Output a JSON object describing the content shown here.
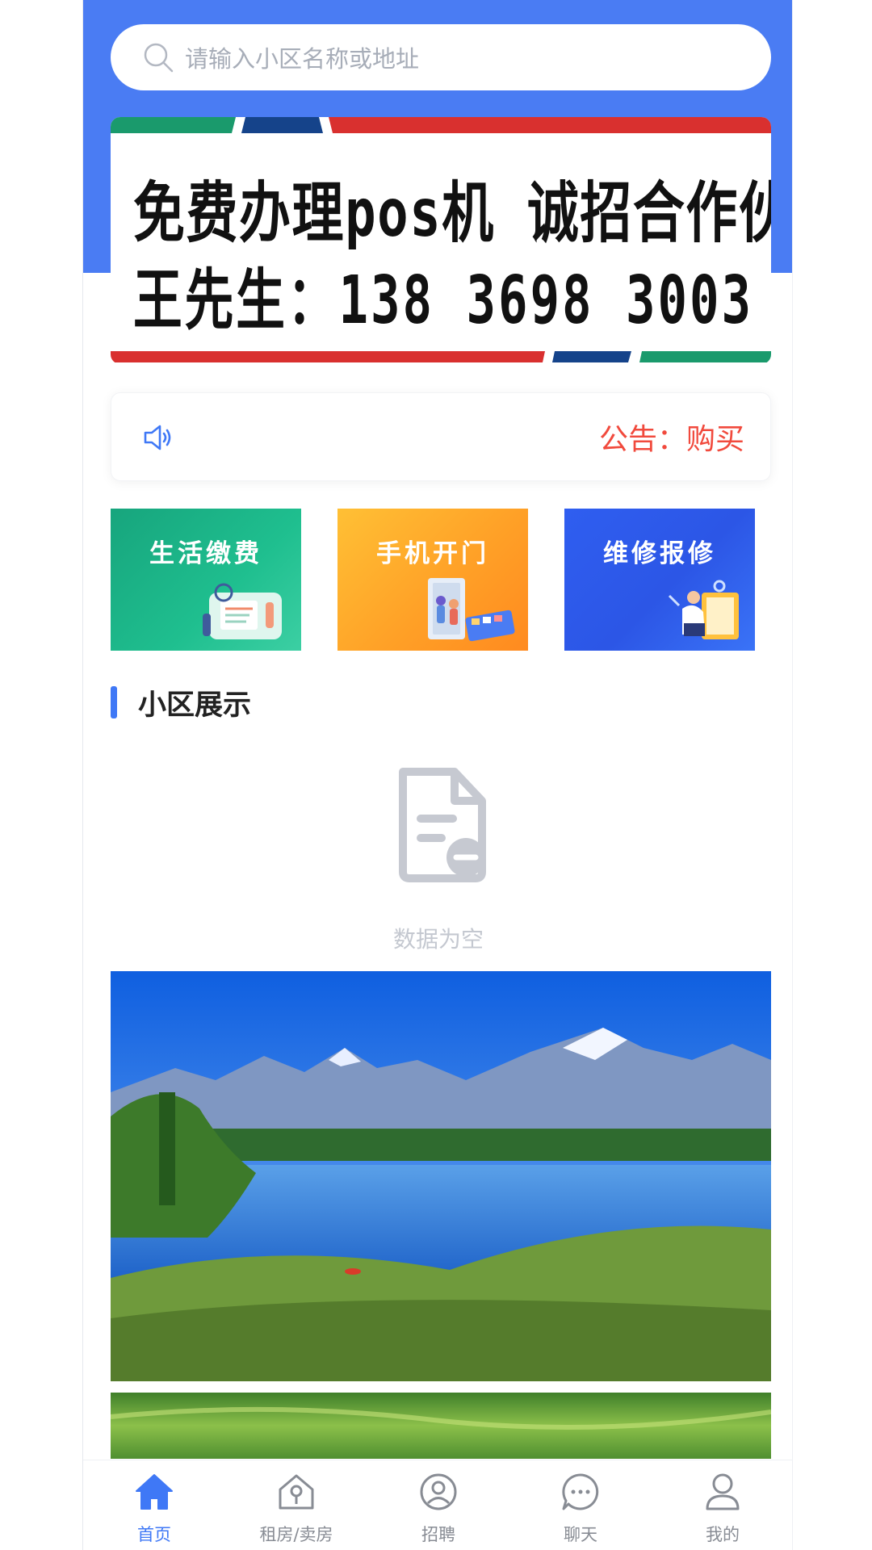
{
  "search": {
    "placeholder": "请输入小区名称或地址"
  },
  "banner": {
    "line1": "免费办理pos机  诚招合作伙伴",
    "line2": "王先生：138 3698 3003"
  },
  "notice": {
    "text": "公告：购买"
  },
  "services": [
    {
      "label": "生活缴费",
      "icon": "bill-payment-illustration",
      "color": "#17a57d"
    },
    {
      "label": "手机开门",
      "icon": "phone-door-illustration",
      "color": "#ffa127"
    },
    {
      "label": "维修报修",
      "icon": "repair-illustration",
      "color": "#2c56e6"
    }
  ],
  "section": {
    "title": "小区展示"
  },
  "empty": {
    "text": "数据为空",
    "icon": "empty-document-icon"
  },
  "tabs": [
    {
      "label": "首页",
      "icon": "home-icon",
      "active": true
    },
    {
      "label": "租房/卖房",
      "icon": "house-key-icon",
      "active": false
    },
    {
      "label": "招聘",
      "icon": "recruit-icon",
      "active": false
    },
    {
      "label": "聊天",
      "icon": "chat-icon",
      "active": false
    },
    {
      "label": "我的",
      "icon": "user-icon",
      "active": false
    }
  ],
  "colors": {
    "header_blue": "#4a7cf3",
    "accent_blue": "#3f78f6",
    "notice_red": "#f14a3d"
  }
}
